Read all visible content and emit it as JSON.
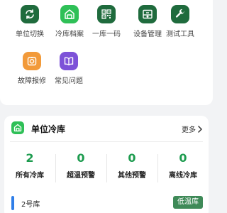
{
  "grid": [
    {
      "label": "单位切换",
      "icon": "swap-icon",
      "color": "#1f6b3d"
    },
    {
      "label": "冷库档案",
      "icon": "warehouse-icon",
      "color": "#2fc057"
    },
    {
      "label": "一库一码",
      "icon": "qr-code-icon",
      "color": "#1f6b3d"
    },
    {
      "label": "设备管理",
      "icon": "device-icon",
      "color": "#1f6b3d"
    },
    {
      "label": "测试工具",
      "icon": "wrench-icon",
      "color": "#1f6b3d"
    },
    {
      "label": "故障报修",
      "icon": "repair-icon",
      "color": "#f29a3a"
    },
    {
      "label": "常见问题",
      "icon": "book-icon",
      "color": "#7d52d8"
    }
  ],
  "section": {
    "title": "单位冷库",
    "more_label": "更多",
    "stats": [
      {
        "value": "2",
        "label": "所有冷库"
      },
      {
        "value": "0",
        "label": "超温预警"
      },
      {
        "value": "0",
        "label": "其他预警"
      },
      {
        "value": "0",
        "label": "离线冷库"
      }
    ],
    "rows": [
      {
        "name": "2号库",
        "badge": "低温库",
        "bar_color": "#2f7ee8",
        "badge_color": "#3f8a58"
      }
    ]
  }
}
